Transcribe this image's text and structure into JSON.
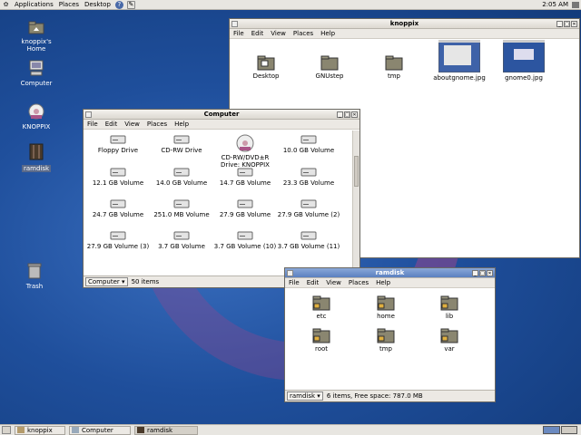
{
  "topbar": {
    "menus": [
      "Applications",
      "Places",
      "Desktop"
    ],
    "clock": "2:05 AM"
  },
  "desktop_icons": [
    {
      "label": "knoppix's Home",
      "icon": "home-folder-icon"
    },
    {
      "label": "Computer",
      "icon": "computer-icon"
    },
    {
      "label": "KNOPPIX",
      "icon": "cdrom-icon"
    },
    {
      "label": "ramdisk",
      "icon": "drive-icon"
    },
    {
      "label": "Trash",
      "icon": "trash-icon"
    }
  ],
  "knoppix_window": {
    "title": "knoppix",
    "menu": [
      "File",
      "Edit",
      "View",
      "Places",
      "Help"
    ],
    "items": [
      "Desktop",
      "GNUstep",
      "tmp",
      "aboutgnome.jpg",
      "gnome0.jpg"
    ]
  },
  "computer_window": {
    "title": "Computer",
    "menu": [
      "File",
      "Edit",
      "View",
      "Places",
      "Help"
    ],
    "items": [
      "Floppy Drive",
      "CD-RW Drive",
      "CD-RW/DVD±R Drive: KNOPPIX",
      "10.0 GB Volume",
      "12.1 GB Volume",
      "14.0 GB Volume",
      "14.7 GB Volume",
      "23.3 GB Volume",
      "24.7 GB Volume",
      "251.0 MB Volume",
      "27.9 GB Volume",
      "27.9 GB Volume (2)",
      "27.9 GB Volume (3)",
      "3.7 GB Volume",
      "3.7 GB Volume (10)",
      "3.7 GB Volume (11)"
    ],
    "status_location": "Computer",
    "status_text": "50 items"
  },
  "ramdisk_window": {
    "title": "ramdisk",
    "menu": [
      "File",
      "Edit",
      "View",
      "Places",
      "Help"
    ],
    "items": [
      "etc",
      "home",
      "lib",
      "root",
      "tmp",
      "var"
    ],
    "status_location": "ramdisk",
    "status_text": "6 items, Free space: 787.0 MB"
  },
  "taskbar": [
    "knoppix",
    "Computer",
    "ramdisk"
  ],
  "colors": {
    "desktop": "#1f4f9c",
    "active_title": "#5a80c0",
    "folder": "#8a8670"
  }
}
